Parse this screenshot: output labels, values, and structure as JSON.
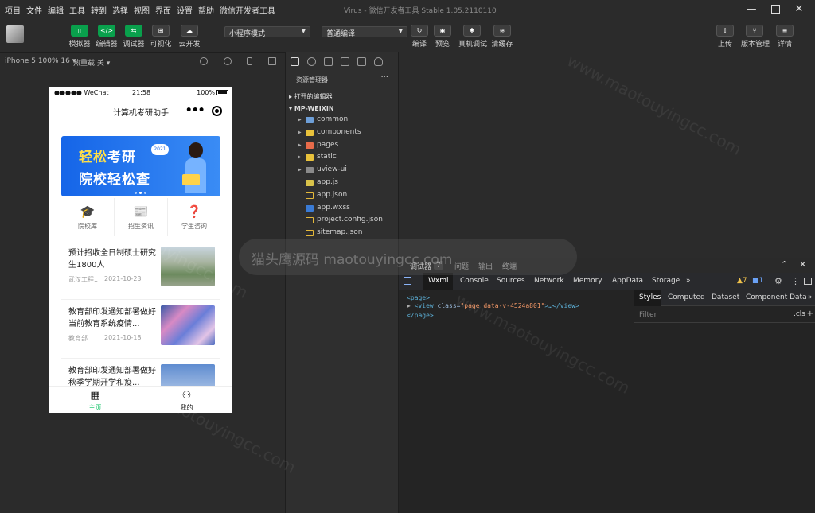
{
  "menu": [
    "项目",
    "文件",
    "编辑",
    "工具",
    "转到",
    "选择",
    "视图",
    "界面",
    "设置",
    "帮助",
    "微信开发者工具"
  ],
  "window_title": "Virus - 微信开发者工具 Stable 1.05.2110110",
  "toolbar": {
    "simulator": "模拟器",
    "editor": "编辑器",
    "debugger": "调试器",
    "visual": "可视化",
    "cloud": "云开发",
    "mode_select": "小程序模式",
    "compile_select": "普通编译",
    "compile": "编译",
    "preview": "预览",
    "real_debug": "真机调试",
    "clear_cache": "清缓存",
    "upload": "上传",
    "version": "版本管理",
    "details": "详情"
  },
  "simbar": {
    "device": "iPhone 5 100% 16 ▾",
    "hotreload": "热重载 关 ▾"
  },
  "phone": {
    "carrier": "●●●●● WeChat",
    "time": "21:58",
    "battery": "100%",
    "title": "计算机考研助手",
    "banner_line1_yellow": "轻松",
    "banner_line1_white": "考研",
    "banner_line2": "院校轻松查",
    "banner_badge": "2021",
    "shortcuts": [
      {
        "icon": "🎓",
        "label": "院校库"
      },
      {
        "icon": "📰",
        "label": "招生资讯"
      },
      {
        "icon": "❓",
        "label": "学生咨询"
      }
    ],
    "news": [
      {
        "title": "预计招收全日制硕士研究生1800人",
        "source": "武汉工程...",
        "date": "2021-10-23"
      },
      {
        "title": "教育部印发通知部署做好当前教育系统疫情...",
        "source": "教育部",
        "date": "2021-10-18"
      },
      {
        "title": "教育部印发通知部署做好秋季学期开学和疫...",
        "source": "",
        "date": ""
      }
    ],
    "tabs": [
      {
        "icon": "▦",
        "label": "主页"
      },
      {
        "icon": "⚇",
        "label": "我的"
      }
    ]
  },
  "explorer": {
    "header": "资源管理器",
    "open_editors": "打开的编辑器",
    "project": "MP-WEIXIN",
    "items": [
      {
        "name": "common",
        "type": "folder",
        "color": "blue"
      },
      {
        "name": "components",
        "type": "folder",
        "color": "yellow"
      },
      {
        "name": "pages",
        "type": "folder",
        "color": "orange"
      },
      {
        "name": "static",
        "type": "folder",
        "color": "yellow"
      },
      {
        "name": "uview-ui",
        "type": "folder",
        "color": "gray"
      },
      {
        "name": "app.js",
        "type": "file",
        "color": "js"
      },
      {
        "name": "app.json",
        "type": "file",
        "color": "json"
      },
      {
        "name": "app.wxss",
        "type": "file",
        "color": "wxss"
      },
      {
        "name": "project.config.json",
        "type": "file",
        "color": "json"
      },
      {
        "name": "sitemap.json",
        "type": "file",
        "color": "json"
      }
    ]
  },
  "debugger": {
    "tabs": [
      "调试器",
      "问题",
      "输出",
      "终端"
    ],
    "count": "7",
    "dev_tabs": [
      "Wxml",
      "Console",
      "Sources",
      "Network",
      "Memory",
      "AppData",
      "Storage"
    ],
    "more": "»",
    "warnings": "▲7",
    "infos": "■1",
    "dom": {
      "line1": "<page>",
      "line2_tag": "<view",
      "line2_attr": " class=",
      "line2_val": "\"page data-v-4524a801\"",
      "line2_end": ">…</view>",
      "line3": "</page>"
    },
    "styles_tabs": [
      "Styles",
      "Computed",
      "Dataset",
      "Component Data"
    ],
    "filter": "Filter",
    "cls": ".cls",
    "plus": "+"
  },
  "watermark": "猫头鹰源码 maotouyingcc.com",
  "watermark_small": "www.maotouyingcc.com",
  "colors": {
    "accent": "#09a04c",
    "banner": "#1565e8",
    "tab_active": "#07c160"
  }
}
